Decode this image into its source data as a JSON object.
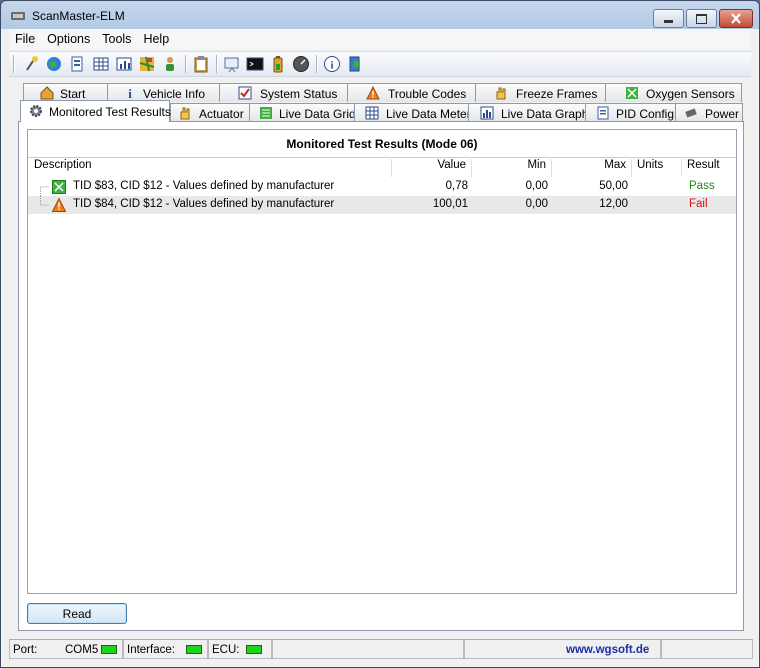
{
  "window": {
    "title": "ScanMaster-ELM"
  },
  "menu": [
    "File",
    "Options",
    "Tools",
    "Help"
  ],
  "toolbar": {
    "icons": [
      "connect-icon",
      "globe-icon",
      "document-icon",
      "grid-icon",
      "chart-icon",
      "map-icon",
      "person-icon",
      "clipboard-icon",
      "monitor-icon",
      "terminal-icon",
      "battery-icon",
      "gauge-icon",
      "info-icon",
      "exit-icon"
    ]
  },
  "tabs": {
    "row1": [
      "Start",
      "Vehicle Info",
      "System Status",
      "Trouble Codes",
      "Freeze Frames",
      "Oxygen Sensors"
    ],
    "row2": [
      "Monitored Test Results",
      "Actuator",
      "Live Data Grid",
      "Live Data Meter",
      "Live Data Graph",
      "PID Config",
      "Power"
    ]
  },
  "panel": {
    "title": "Monitored Test Results (Mode 06)",
    "columns": [
      "Description",
      "Value",
      "Min",
      "Max",
      "Units",
      "Result"
    ],
    "rows": [
      {
        "description": "TID $83, CID $12 - Values defined by manufacturer",
        "value": "0,78",
        "min": "0,00",
        "max": "50,00",
        "units": "",
        "result": "Pass"
      },
      {
        "description": "TID $84, CID $12 - Values defined by manufacturer",
        "value": "100,01",
        "min": "0,00",
        "max": "12,00",
        "units": "",
        "result": "Fail"
      }
    ],
    "read_label": "Read"
  },
  "status": {
    "port_label": "Port:",
    "port_value": "COM5",
    "interface_label": "Interface:",
    "ecu_label": "ECU:",
    "url": "www.wgsoft.de"
  },
  "colors": {
    "pass": "#1a8a1a",
    "fail": "#d01010",
    "led": "#1fd31f"
  }
}
